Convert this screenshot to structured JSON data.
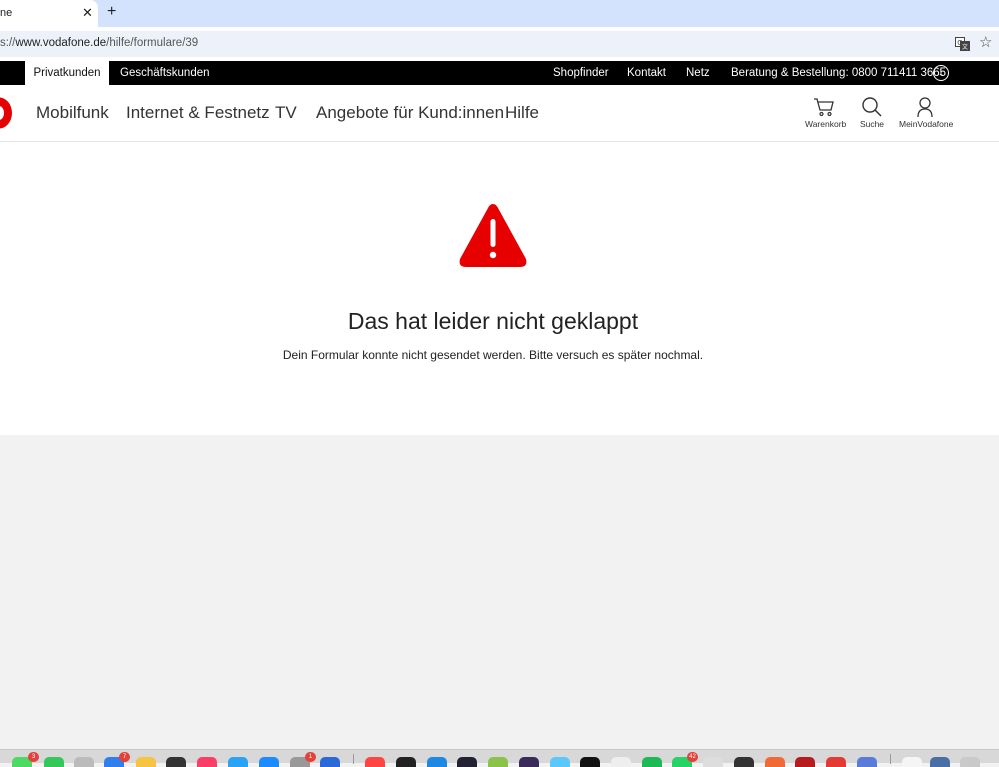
{
  "browser": {
    "tab_title": "ne",
    "tab_close": "✕",
    "new_tab": "+",
    "url_prefix": "s://",
    "url_host": "www.vodafone.de",
    "url_path": "/hilfe/formulare/39",
    "star": "☆"
  },
  "topbar": {
    "segments": [
      "Privatkunden",
      "Geschäftskunden"
    ],
    "links": [
      "Shopfinder",
      "Kontakt",
      "Netz"
    ],
    "hotline": "Beratung & Bestellung: 0800 711411 3665",
    "info": "i"
  },
  "nav": {
    "items": [
      "Mobilfunk",
      "Internet & Festnetz",
      "TV",
      "Angebote für Kund:innen",
      "Hilfe"
    ],
    "utilities": [
      "Warenkorb",
      "Suche",
      "MeinVodafone"
    ]
  },
  "error": {
    "title": "Das hat leider nicht geklappt",
    "message": "Dein Formular konnte nicht gesendet werden. Bitte versuch es später nochmal."
  },
  "dock": {
    "badges": [
      "3",
      "7",
      "1",
      "42"
    ]
  },
  "colors": {
    "brand_red": "#e60000",
    "tab_strip": "#d3e3fd",
    "topbar": "#000000"
  }
}
